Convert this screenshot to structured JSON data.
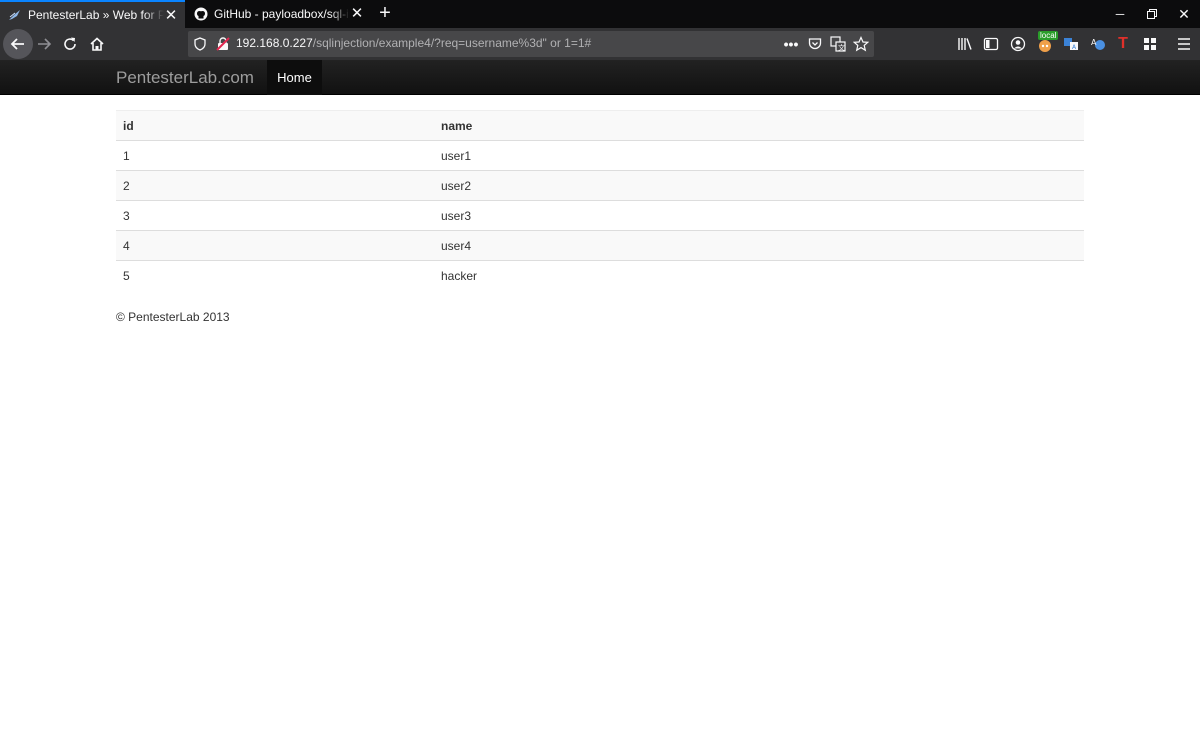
{
  "tabs": [
    {
      "title": "PentesterLab » Web for Pentester",
      "favicon": "pentesterlab-icon"
    },
    {
      "title": "GitHub - payloadbox/sql-injection-payload-list",
      "favicon": "github-icon"
    }
  ],
  "url": {
    "host": "192.168.0.227",
    "path": "/sqlinjection/example4/?req=username%3d\" or 1=1#"
  },
  "extension_badge": "local",
  "site": {
    "brand": "PentesterLab.com",
    "home": "Home"
  },
  "table": {
    "headers": [
      "id",
      "name"
    ],
    "rows": [
      {
        "id": "1",
        "name": "user1"
      },
      {
        "id": "2",
        "name": "user2"
      },
      {
        "id": "3",
        "name": "user3"
      },
      {
        "id": "4",
        "name": "user4"
      },
      {
        "id": "5",
        "name": "hacker"
      }
    ]
  },
  "footer": "© PentesterLab 2013",
  "colors": {
    "accent": "#0a84ff",
    "toolbar": "#323234",
    "tabstrip": "#0c0c0d"
  }
}
